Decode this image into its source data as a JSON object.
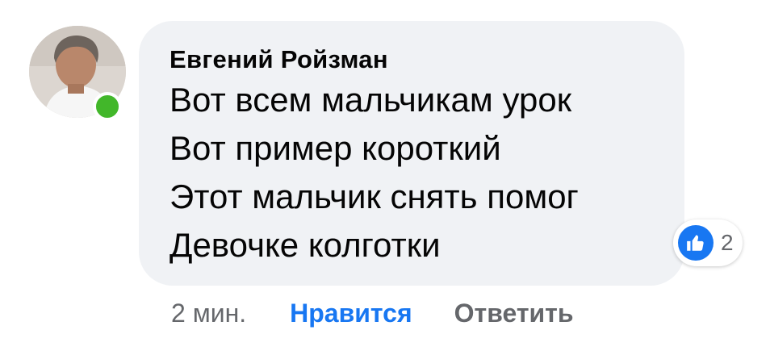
{
  "comment": {
    "author": "Евгений Ройзман",
    "lines": [
      "Вот всем мальчикам урок",
      "Вот пример короткий",
      "Этот мальчик снять помог",
      "Девочке колготки"
    ],
    "avatar_icon": "profile-photo",
    "online_status_color": "#42b72a",
    "reactions": {
      "icon": "thumbs-up-icon",
      "count": "2",
      "color": "#1877f2"
    },
    "actions": {
      "time": "2 мин.",
      "like_label": "Нравится",
      "reply_label": "Ответить"
    }
  }
}
